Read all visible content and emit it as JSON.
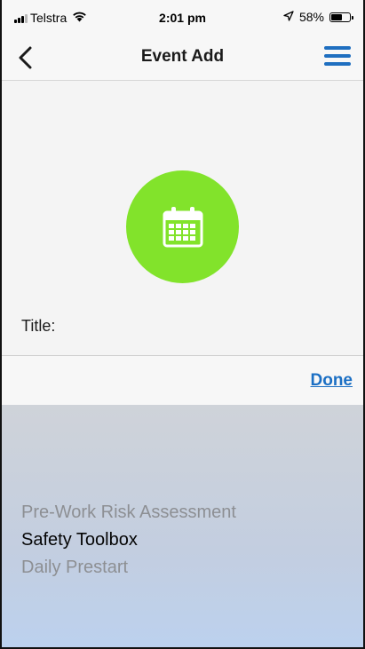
{
  "status_bar": {
    "carrier": "Telstra",
    "time": "2:01 pm",
    "battery": "58%",
    "battery_level": 0.58
  },
  "nav": {
    "title": "Event Add",
    "back_icon": "chevron-left-icon",
    "menu_icon": "hamburger-menu-icon"
  },
  "content": {
    "event_icon": "calendar-icon",
    "icon_color": "#82e32b",
    "title_label": "Title:"
  },
  "toolbar": {
    "done_label": "Done"
  },
  "picker": {
    "options": [
      "Pre-Work Risk Assessment",
      "Safety Toolbox",
      "Daily Prestart"
    ],
    "selected": "Safety Toolbox"
  },
  "colors": {
    "accent": "#1b6fc4",
    "event_green": "#82e32b"
  }
}
